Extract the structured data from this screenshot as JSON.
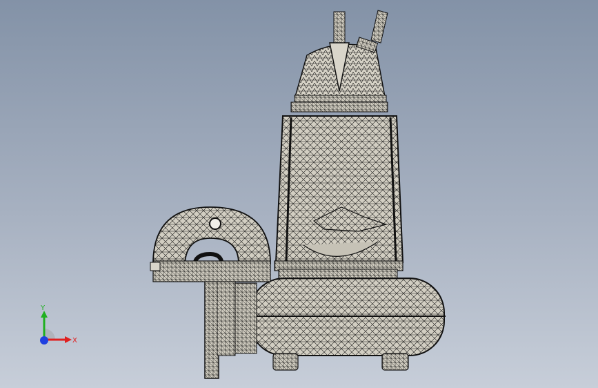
{
  "viewport": {
    "background_top": "#8392a7",
    "background_bottom": "#c7ced9"
  },
  "model": {
    "part_color": "#cfcbbf",
    "edge_color": "#111111"
  },
  "triad": {
    "x_label": "X",
    "y_label": "Y",
    "x_color": "#e02020",
    "y_color": "#20b020",
    "z_color": "#2040e0"
  }
}
